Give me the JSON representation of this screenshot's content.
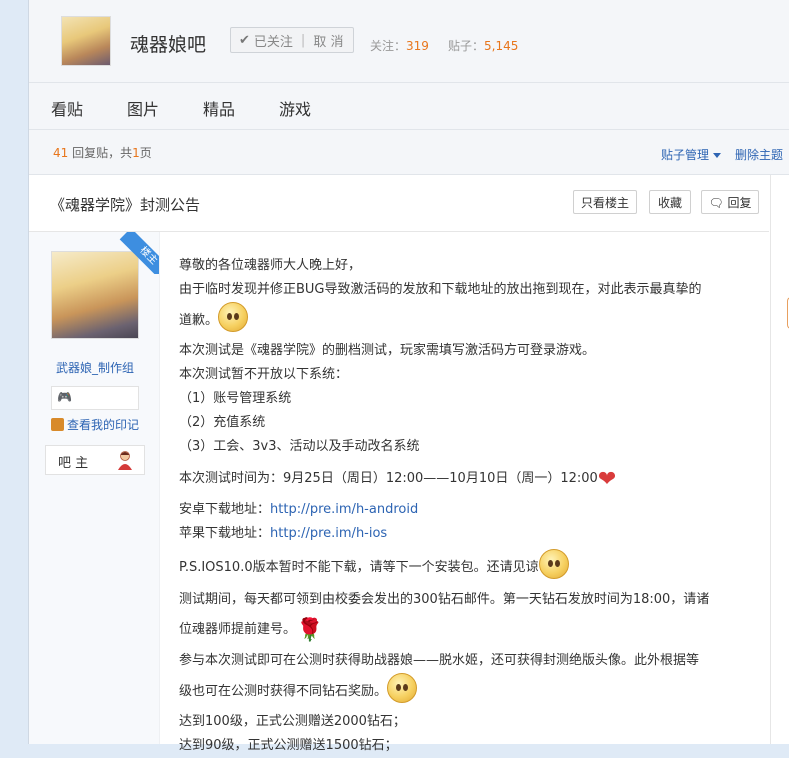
{
  "forum": {
    "name": "魂器娘吧",
    "follow_label": "已关注",
    "unfollow_label": "取 消",
    "followers_label": "关注：",
    "followers": "319",
    "posts_label": "贴子：",
    "posts": "5,145"
  },
  "nav": {
    "items": [
      "看贴",
      "图片",
      "精品",
      "游戏"
    ]
  },
  "pager": {
    "reply_count": "41",
    "reply_text": "回复贴，共",
    "page_count": "1",
    "page_suffix": "页",
    "manage_label": "贴子管理",
    "delete_label": "删除主题"
  },
  "thread": {
    "title": "《魂器学院》封测公告",
    "only_op_label": "只看楼主",
    "collect_label": "收藏",
    "reply_label": "回复"
  },
  "author": {
    "name": "武器娘_制作组",
    "ribbon": "楼主",
    "badge_glyph": "🎮",
    "imprint_label": "查看我的印记",
    "role": "吧 主"
  },
  "post": {
    "lines": [
      "尊敬的各位魂器师大人晚上好，",
      "由于临时发现并修正BUG导致激活码的发放和下载地址的放出拖到现在，对此表示最真挚的",
      "道歉。",
      "本次测试是《魂器学院》的删档测试，玩家需填写激活码方可登录游戏。",
      "本次测试暂不开放以下系统：",
      "（1）账号管理系统",
      "（2）充值系统",
      "（3）工会、3v3、活动以及手动改名系统",
      "本次测试时间为：9月25日（周日）12:00——10月10日（周一）12:00",
      "安卓下载地址：",
      "http://pre.im/h-android",
      "苹果下载地址：",
      "http://pre.im/h-ios",
      "P.S.IOS10.0版本暂时不能下载，请等下一个安装包。还请见谅",
      "测试期间，每天都可领到由校委会发出的300钻石邮件。第一天钻石发放时间为18:00，请诸",
      "位魂器师提前建号。",
      "参与本次测试即可在公测时获得助战器娘——脱水姬，还可获得封测绝版头像。此外根据等",
      "级也可在公测时获得不同钻石奖励。",
      "达到100级，正式公测赠送2000钻石；",
      "达到90级，正式公测赠送1500钻石；"
    ]
  },
  "colors": {
    "accent_orange": "#e8761c",
    "link_blue": "#2d64b3",
    "ribbon_blue": "#3d8ee0"
  }
}
